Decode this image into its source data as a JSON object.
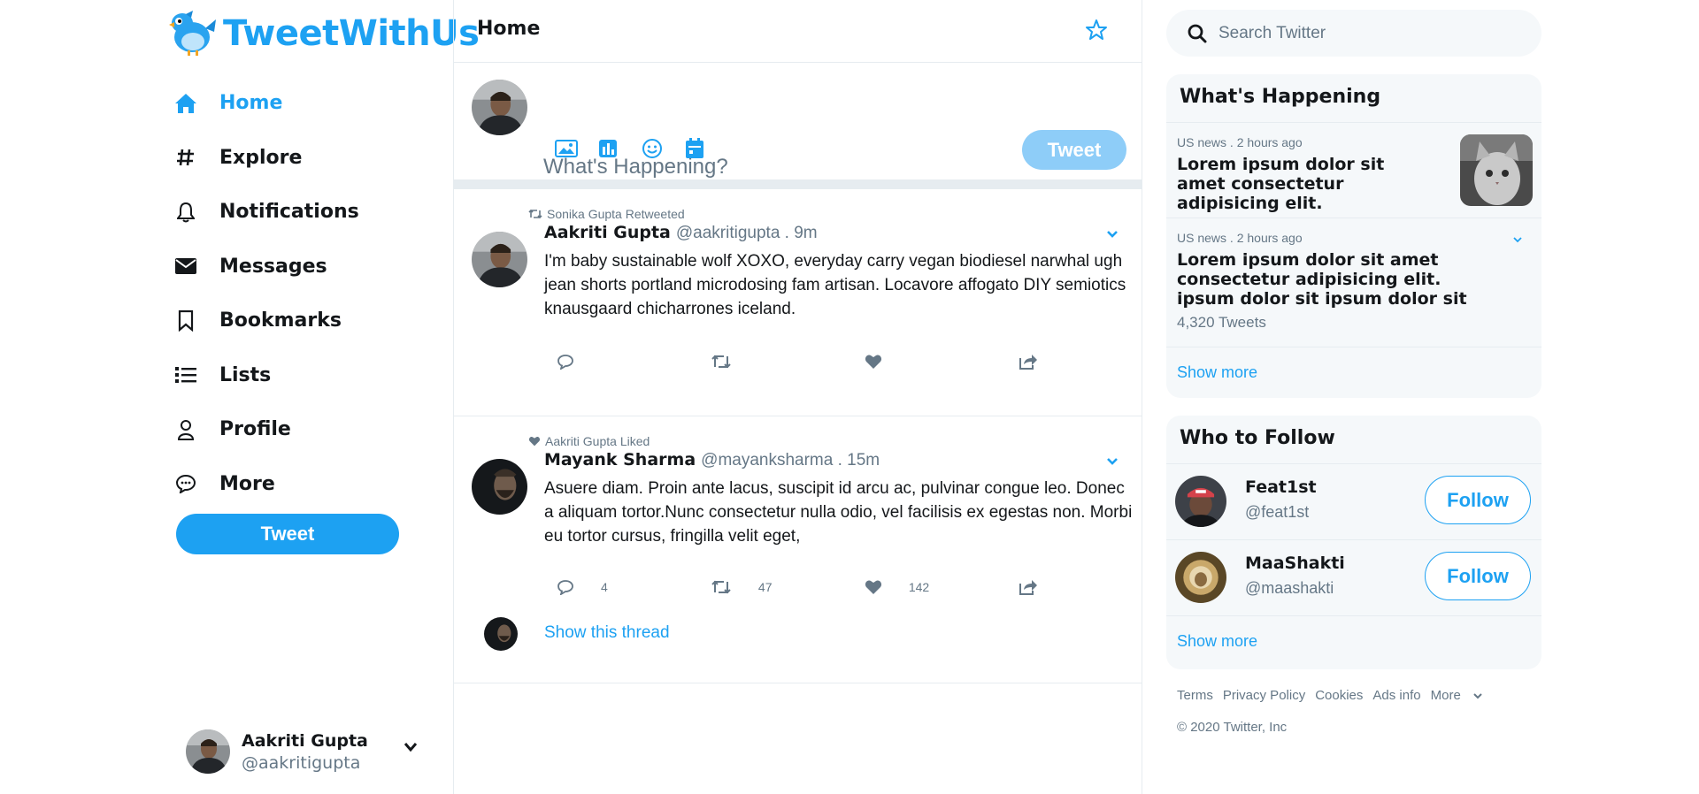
{
  "brand": {
    "name": "TweetWithUs"
  },
  "nav": {
    "items": [
      {
        "label": "Home",
        "icon": "home-icon",
        "active": true
      },
      {
        "label": "Explore",
        "icon": "hashtag-icon"
      },
      {
        "label": "Notifications",
        "icon": "bell-icon"
      },
      {
        "label": "Messages",
        "icon": "envelope-icon"
      },
      {
        "label": "Bookmarks",
        "icon": "bookmark-icon"
      },
      {
        "label": "Lists",
        "icon": "list-icon"
      },
      {
        "label": "Profile",
        "icon": "user-icon"
      },
      {
        "label": "More",
        "icon": "more-icon"
      }
    ],
    "tweet_label": "Tweet"
  },
  "account": {
    "name": "Aakriti Gupta",
    "handle": "@aakritigupta"
  },
  "center": {
    "title": "Home",
    "composer": {
      "placeholder": "What's Happening?",
      "tools": [
        "image-icon",
        "poll-icon",
        "emoji-icon",
        "schedule-icon"
      ],
      "tweet_label": "Tweet"
    },
    "tweets": [
      {
        "context": "Sonika Gupta Retweeted",
        "context_icon": "retweet-icon",
        "name": "Aakriti Gupta",
        "handle_time": "@aakritigupta . 9m",
        "body": "I'm baby sustainable wolf XOXO, everyday carry vegan biodiesel narwhal ugh jean shorts portland microdosing fam artisan. Locavore affogato DIY semiotics knausgaard chicharrones iceland.",
        "counts": {
          "reply": "",
          "retweet": "",
          "like": ""
        }
      },
      {
        "context": "Aakriti Gupta Liked",
        "context_icon": "heart-icon",
        "name": "Mayank Sharma",
        "handle_time": "@mayanksharma . 15m",
        "body": "Asuere diam. Proin ante lacus, suscipit id arcu ac, pulvinar congue leo. Donec a aliquam tortor.Nunc consectetur nulla odio, vel facilisis ex egestas non. Morbi eu tortor cursus, fringilla velit eget,",
        "counts": {
          "reply": "4",
          "retweet": "47",
          "like": "142"
        },
        "thread_label": "Show this thread"
      }
    ]
  },
  "right": {
    "search_placeholder": "Search Twitter",
    "happening": {
      "title": "What's Happening",
      "trends": [
        {
          "meta": "US news . 2 hours ago",
          "headline": "Lorem ipsum dolor sit amet consectetur adipisicing elit."
        },
        {
          "meta": "US news . 2 hours ago",
          "headline": "Lorem ipsum dolor sit amet consectetur adipisicing elit. ipsum dolor sit ipsum dolor sit",
          "count": "4,320 Tweets"
        }
      ],
      "show_more": "Show more"
    },
    "follow": {
      "title": "Who to Follow",
      "users": [
        {
          "name": "Feat1st",
          "handle": "@feat1st",
          "button": "Follow"
        },
        {
          "name": "MaaShakti",
          "handle": "@maashakti",
          "button": "Follow"
        }
      ],
      "show_more": "Show more"
    },
    "footer": {
      "links": [
        "Terms",
        "Privacy Policy",
        "Cookies",
        "Ads info"
      ],
      "more": "More",
      "copyright": "© 2020 Twitter, Inc"
    }
  },
  "colors": {
    "accent": "#1da1f2",
    "accent_light": "#8ecdf8",
    "muted": "#657786",
    "panel": "#f5f8fa",
    "border": "#e6ecf0"
  }
}
